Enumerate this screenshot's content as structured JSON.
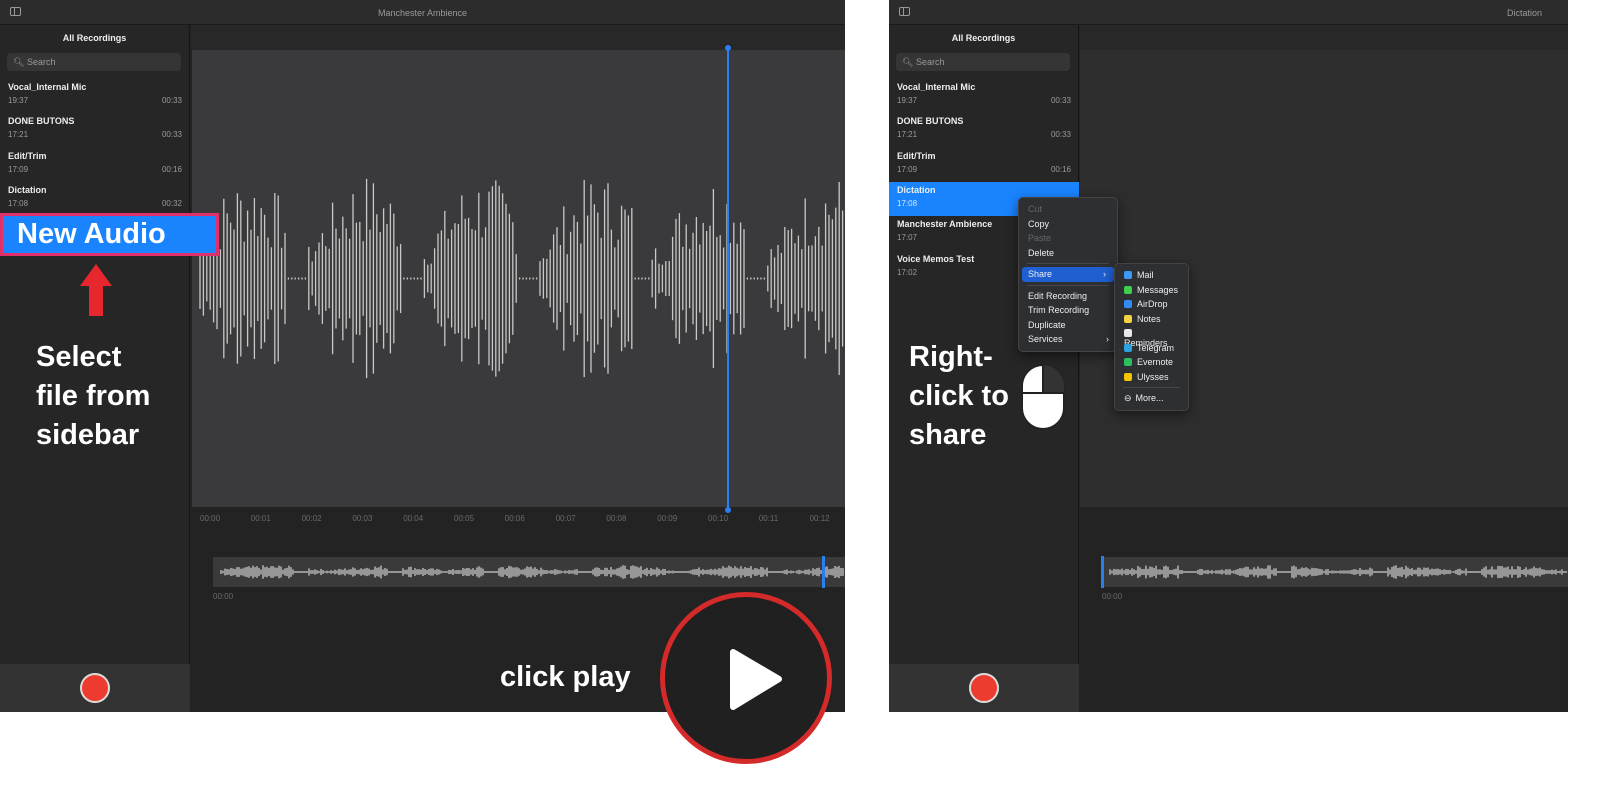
{
  "left_window": {
    "title": "Manchester Ambience",
    "sidebar_title": "All Recordings",
    "search_placeholder": "Search",
    "recordings": [
      {
        "name": "Vocal_Internal Mic",
        "time": "19:37",
        "duration": "00:33"
      },
      {
        "name": "DONE BUTONS",
        "time": "17:21",
        "duration": "00:33"
      },
      {
        "name": "Edit/Trim",
        "time": "17:09",
        "duration": "00:16"
      },
      {
        "name": "Dictation",
        "time": "17:08",
        "duration": "00:32"
      }
    ],
    "timeline": [
      "00:00",
      "00:01",
      "00:02",
      "00:03",
      "00:04",
      "00:05",
      "00:06",
      "00:07",
      "00:08",
      "00:09",
      "00:10",
      "00:11",
      "00:12"
    ],
    "overview_start": "00:00",
    "playhead_time": "00:10"
  },
  "right_window": {
    "title": "Dictation",
    "sidebar_title": "All Recordings",
    "search_placeholder": "Search",
    "recordings": [
      {
        "name": "Vocal_Internal Mic",
        "time": "19:37",
        "duration": "00:33"
      },
      {
        "name": "DONE BUTONS",
        "time": "17:21",
        "duration": "00:33"
      },
      {
        "name": "Edit/Trim",
        "time": "17:09",
        "duration": "00:16"
      },
      {
        "name": "Dictation",
        "time": "17:08",
        "duration": "",
        "selected": true
      },
      {
        "name": "Manchester Ambience",
        "time": "17:07",
        "duration": ""
      },
      {
        "name": "Voice Memos Test",
        "time": "17:02",
        "duration": ""
      }
    ],
    "overview_start": "00:00",
    "context_menu": [
      "Cut",
      "Copy",
      "Paste",
      "Delete",
      "Share",
      "Edit Recording",
      "Trim Recording",
      "Duplicate",
      "Services"
    ],
    "share_menu": [
      {
        "label": "Mail",
        "color": "#3b9af5"
      },
      {
        "label": "Messages",
        "color": "#3ccf4e"
      },
      {
        "label": "AirDrop",
        "color": "#2f8cf0"
      },
      {
        "label": "Notes",
        "color": "#f5d442"
      },
      {
        "label": "Reminders",
        "color": "#e8e8e8"
      },
      {
        "label": "Telegram",
        "color": "#2aa3e0"
      },
      {
        "label": "Evernote",
        "color": "#2dbe60"
      },
      {
        "label": "Ulysses",
        "color": "#f2c500"
      },
      {
        "label": "More...",
        "color": ""
      }
    ]
  },
  "annotations": {
    "new_audio": "New Audio",
    "select_text": [
      "Select",
      "file from",
      "sidebar"
    ],
    "click_play": "click play",
    "right_click": [
      "Right-",
      "click to",
      "share"
    ]
  },
  "colors": {
    "accent": "#1a84ff",
    "record": "#ee3b30",
    "annotation_red": "#d42a2a",
    "highlight_border": "#e0306a"
  }
}
